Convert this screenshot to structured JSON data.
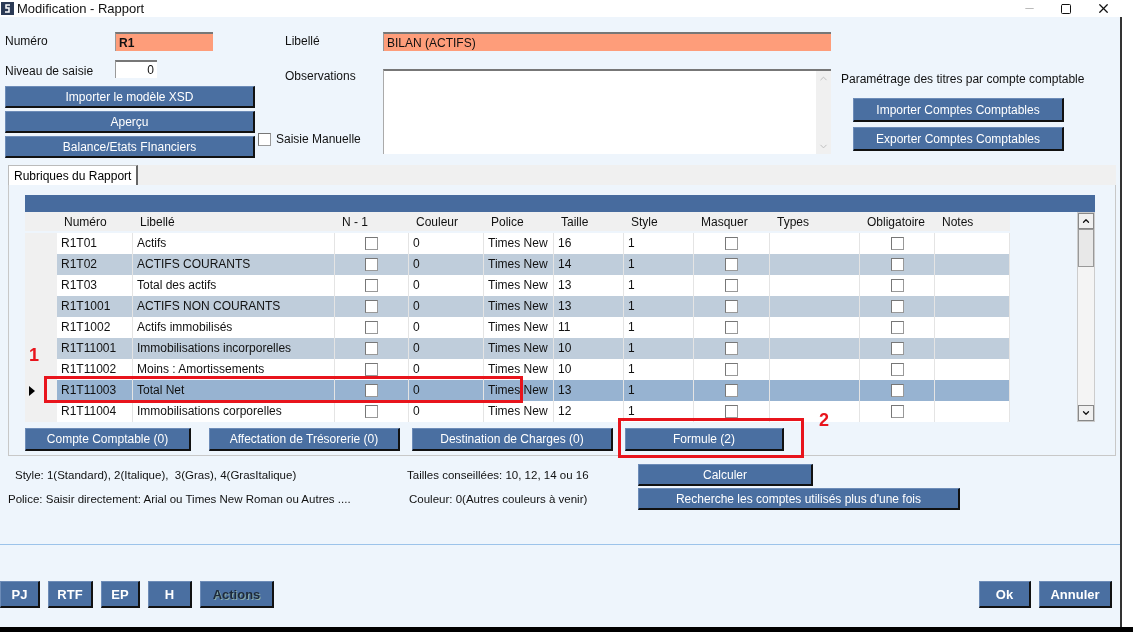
{
  "window": {
    "title": "Modification - Rapport"
  },
  "form": {
    "numero": {
      "label": "Numéro",
      "value": "R1"
    },
    "niveau": {
      "label": "Niveau de saisie",
      "value": "0"
    },
    "libelle": {
      "label": "Libellé",
      "value": "BILAN (ACTIFS)"
    },
    "observations": {
      "label": "Observations"
    },
    "saisie_manuelle": {
      "label": "Saisie Manuelle",
      "checked": false
    }
  },
  "left_buttons": [
    "Importer le modèle XSD",
    "Aperçu",
    "Balance/Etats FInanciers"
  ],
  "accounts": {
    "title": "Paramétrage des titres par compte comptable",
    "buttons": [
      "Importer Comptes Comptables",
      "Exporter Comptes Comptables"
    ]
  },
  "tabs": [
    {
      "label": "Rubriques du Rapport",
      "selected": true
    }
  ],
  "table": {
    "columns": [
      "Numéro",
      "Libellé",
      "N - 1",
      "Couleur",
      "Police",
      "Taille",
      "Style",
      "Masquer",
      "Types",
      "Obligatoire",
      "Notes"
    ],
    "rows": [
      {
        "numero": "R1T01",
        "libelle": "Actifs",
        "n_1": false,
        "couleur": "0",
        "police": "Times New",
        "taille": "16",
        "style": "1",
        "masquer": false,
        "obligatoire": false,
        "selected": false
      },
      {
        "numero": "R1T02",
        "libelle": "ACTIFS COURANTS",
        "n_1": false,
        "couleur": "0",
        "police": "Times New",
        "taille": "14",
        "style": "1",
        "masquer": false,
        "obligatoire": false,
        "selected": false
      },
      {
        "numero": "R1T03",
        "libelle": "Total des actifs",
        "n_1": false,
        "couleur": "0",
        "police": "Times New",
        "taille": "13",
        "style": "1",
        "masquer": false,
        "obligatoire": false,
        "selected": false
      },
      {
        "numero": "R1T1001",
        "libelle": "ACTIFS NON COURANTS",
        "n_1": false,
        "couleur": "0",
        "police": "Times New",
        "taille": "13",
        "style": "1",
        "masquer": false,
        "obligatoire": false,
        "selected": false
      },
      {
        "numero": "R1T1002",
        "libelle": "Actifs immobilisés",
        "n_1": false,
        "couleur": "0",
        "police": "Times New",
        "taille": "11",
        "style": "1",
        "masquer": false,
        "obligatoire": false,
        "selected": false
      },
      {
        "numero": "R1T11001",
        "libelle": "Immobilisations incorporelles",
        "n_1": false,
        "couleur": "0",
        "police": "Times New",
        "taille": "10",
        "style": "1",
        "masquer": false,
        "obligatoire": false,
        "selected": false
      },
      {
        "numero": "R1T11002",
        "libelle": "Moins : Amortissements",
        "n_1": false,
        "couleur": "0",
        "police": "Times New",
        "taille": "10",
        "style": "1",
        "masquer": false,
        "obligatoire": false,
        "selected": false
      },
      {
        "numero": "R1T11003",
        "libelle": "Total Net",
        "n_1": false,
        "couleur": "0",
        "police": "Times New",
        "taille": "13",
        "style": "1",
        "masquer": false,
        "obligatoire": false,
        "selected": true
      },
      {
        "numero": "R1T11004",
        "libelle": "Immobilisations corporelles",
        "n_1": false,
        "couleur": "0",
        "police": "Times New",
        "taille": "12",
        "style": "1",
        "masquer": false,
        "obligatoire": false,
        "selected": false
      }
    ]
  },
  "grid_buttons": [
    "Compte Comptable (0)",
    "Affectation de Trésorerie (0)",
    "Destination de Charges (0)",
    "Formule (2)"
  ],
  "notes": [
    "Style: 1(Standard), 2(Italique),  3(Gras), 4(GrasItalique)",
    "Tailles conseillées: 10, 12, 14 ou 16",
    "Police: Saisir directement: Arial ou Times New Roman ou Autres ....",
    "Couleur: 0(Autres couleurs à venir)"
  ],
  "action_buttons": [
    "Calculer",
    "Recherche les comptes utilisés plus d'une fois"
  ],
  "footer": {
    "left": [
      {
        "label": "PJ",
        "kind": "primary"
      },
      {
        "label": "RTF",
        "kind": "primary"
      },
      {
        "label": "EP",
        "kind": "primary"
      },
      {
        "label": "H",
        "kind": "primary"
      },
      {
        "label": "Actions",
        "kind": "muted"
      }
    ],
    "right": [
      "Ok",
      "Annuler"
    ]
  },
  "annotations": [
    {
      "label": "1"
    },
    {
      "label": "2"
    }
  ]
}
